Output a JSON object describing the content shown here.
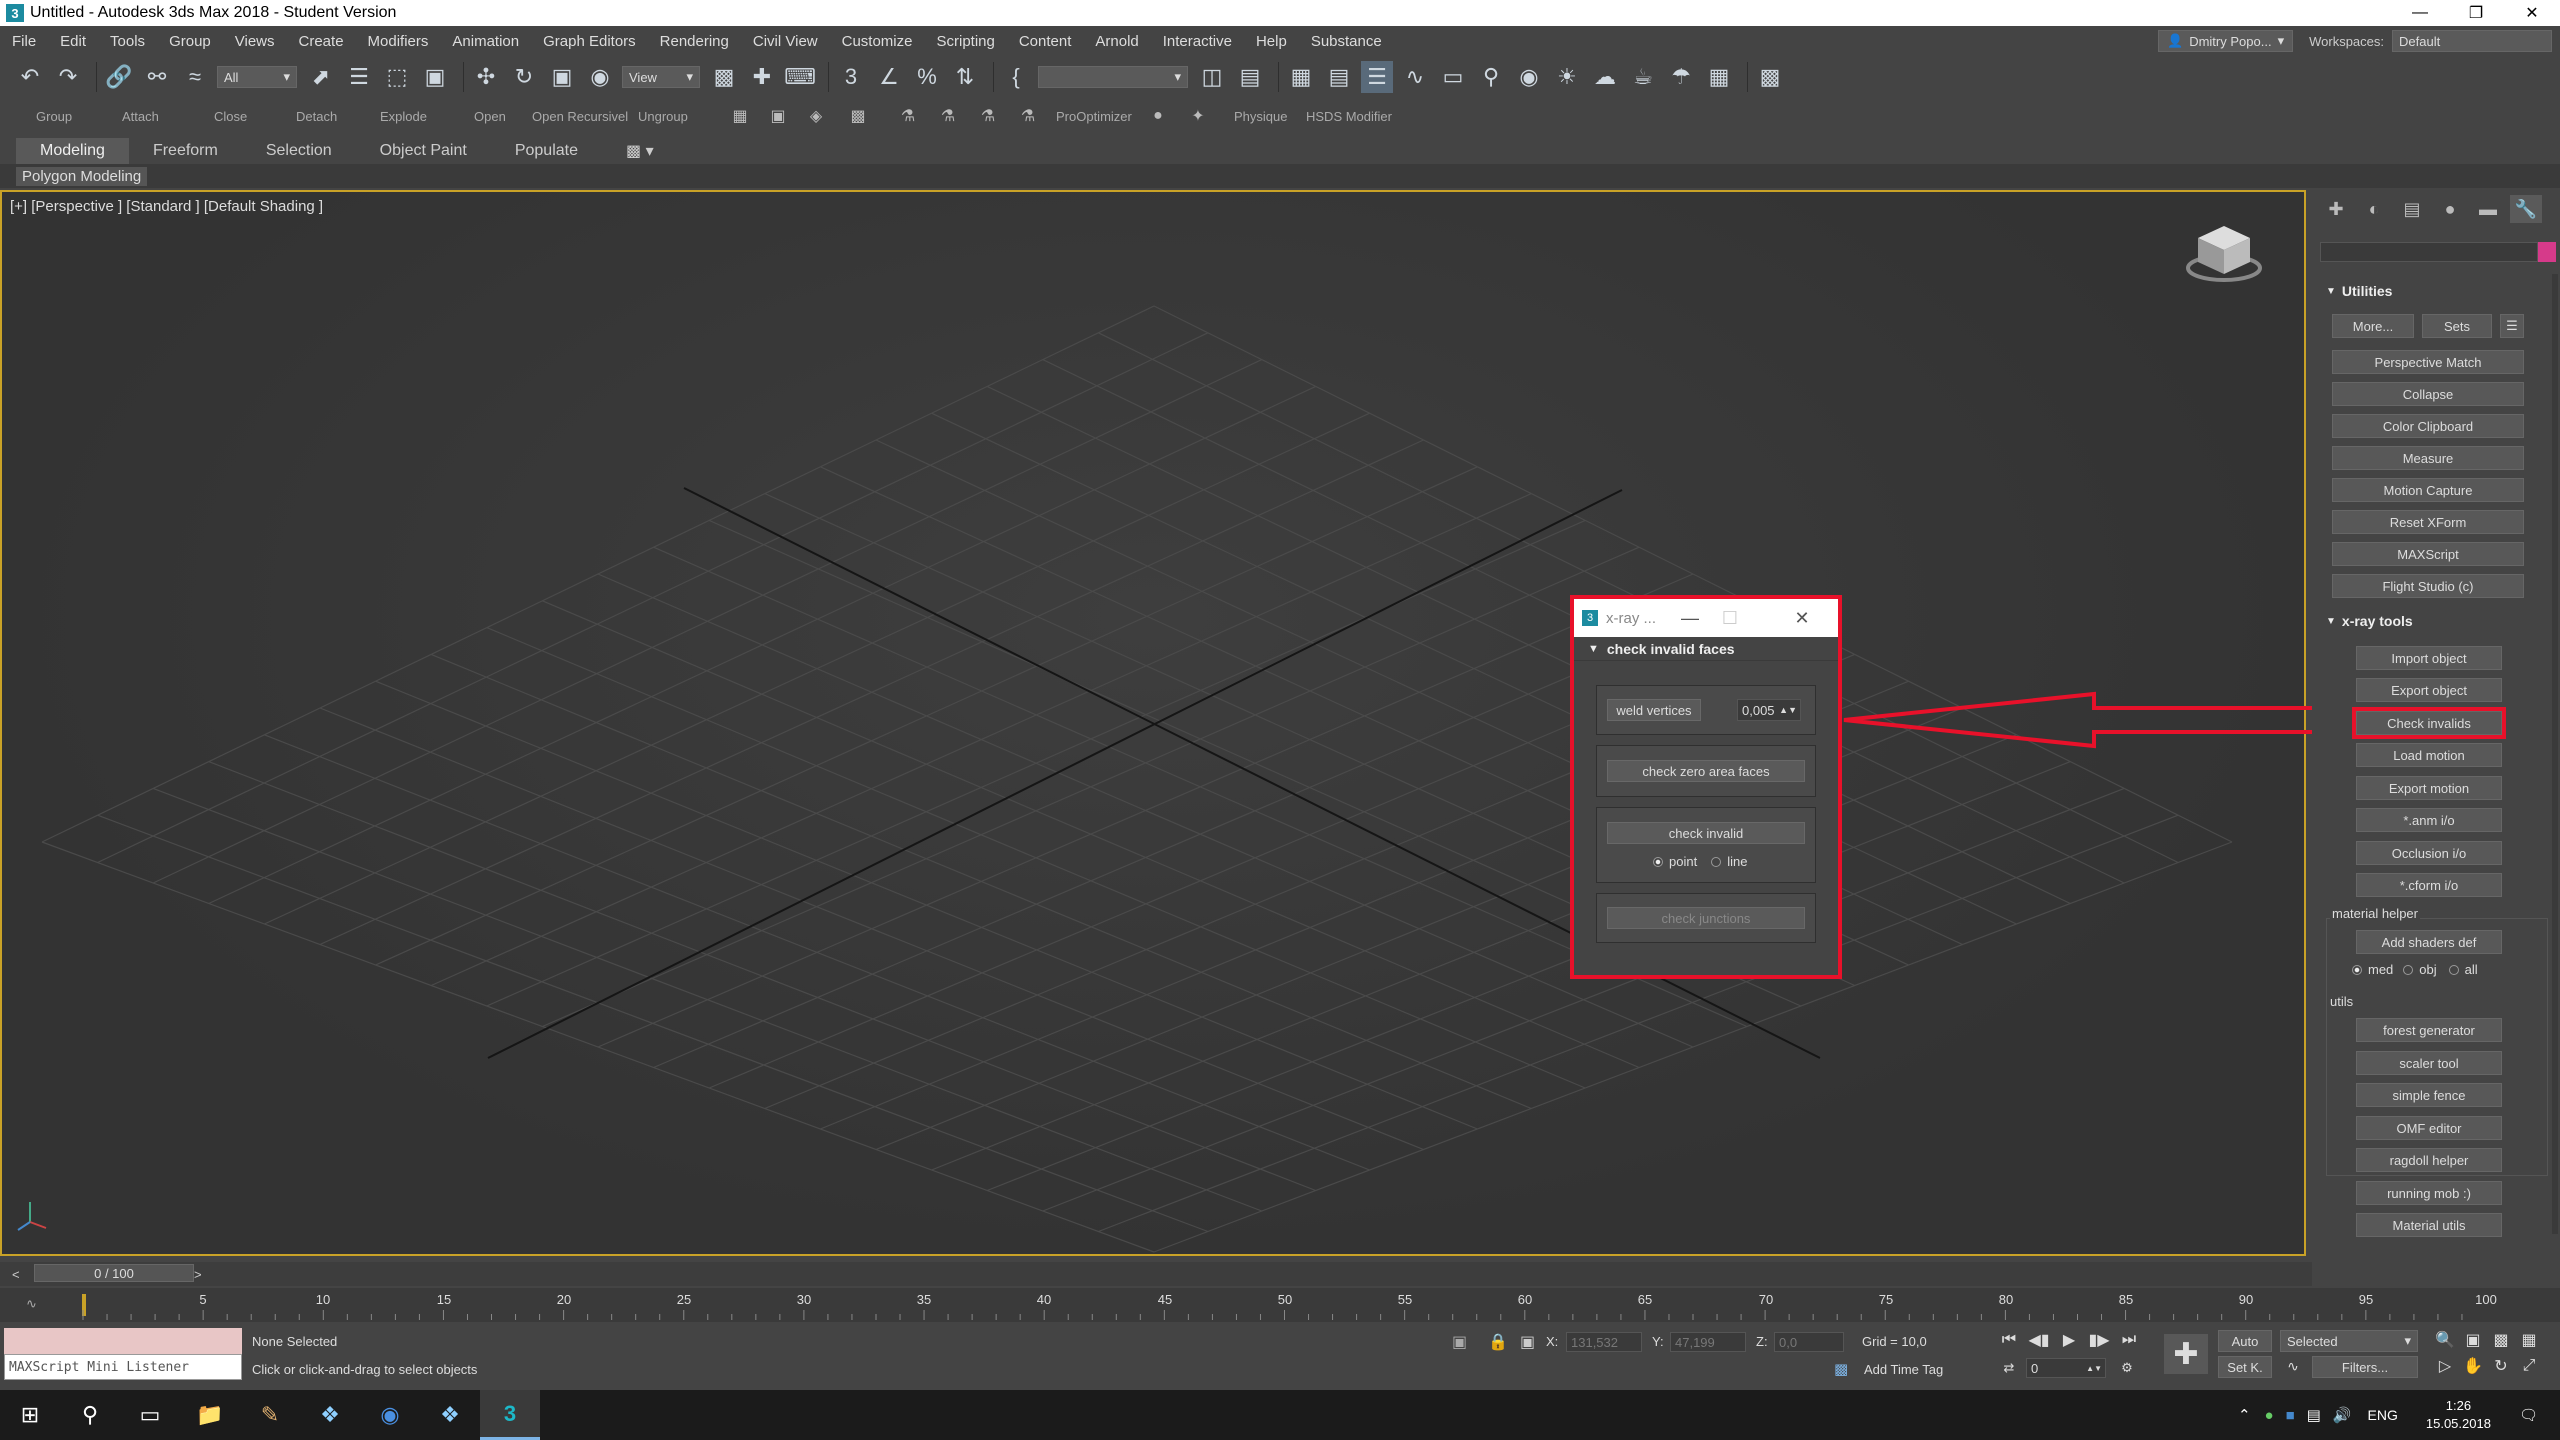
{
  "window": {
    "title": "Untitled - Autodesk 3ds Max 2018 - Student Version",
    "app_icon": "3",
    "controls": [
      "—",
      "❐",
      "✕"
    ]
  },
  "menu": {
    "items": [
      "File",
      "Edit",
      "Tools",
      "Group",
      "Views",
      "Create",
      "Modifiers",
      "Animation",
      "Graph Editors",
      "Rendering",
      "Civil View",
      "Customize",
      "Scripting",
      "Content",
      "Arnold",
      "Interactive",
      "Help",
      "Substance"
    ],
    "user": "Dmitry Popo...",
    "workspaces_label": "Workspaces:",
    "workspace_value": "Default"
  },
  "toolbar": {
    "filter_value": "All",
    "ref_coord_value": "View"
  },
  "commands": {
    "labels": [
      "Group",
      "Attach",
      "Close",
      "Detach",
      "Explode",
      "Open",
      "Open Recursivel",
      "Ungroup",
      "ProOptimizer",
      "Physique",
      "HSDS Modifier"
    ]
  },
  "ribbon": {
    "tabs": [
      "Modeling",
      "Freeform",
      "Selection",
      "Object Paint",
      "Populate"
    ],
    "active_tab": "Modeling",
    "sub_label": "Polygon Modeling"
  },
  "viewport": {
    "label": "[+] [Perspective ] [Standard ] [Default Shading ]"
  },
  "xray_dialog": {
    "title": "x-ray ...",
    "rollout_title": "check invalid faces",
    "weld_vertices_label": "weld vertices",
    "weld_value": "0,005",
    "check_zero_area_label": "check zero area faces",
    "check_invalid_label": "check invalid",
    "radio_point": "point",
    "radio_line": "line",
    "check_junctions_label": "check junctions"
  },
  "command_panel": {
    "accent_color": "#d63a8a",
    "utilities_title": "Utilities",
    "more_label": "More...",
    "sets_label": "Sets",
    "utilities": [
      "Perspective Match",
      "Collapse",
      "Color Clipboard",
      "Measure",
      "Motion Capture",
      "Reset XForm",
      "MAXScript",
      "Flight Studio (c)"
    ],
    "xray_title": "x-ray tools",
    "xray_tools": [
      "Import object",
      "Export object",
      "Check invalids",
      "Load motion",
      "Export motion",
      "*.anm i/o",
      "Occlusion i/o",
      "*.cform i/o"
    ],
    "material_helper_label": "material helper",
    "add_shaders_label": "Add shaders def",
    "mh_radio": [
      "med",
      "obj",
      "all"
    ],
    "utils_label": "utils",
    "utils": [
      "forest generator",
      "scaler tool",
      "simple fence",
      "OMF editor",
      "ragdoll helper",
      "running mob :)",
      "Material utils"
    ]
  },
  "timeline": {
    "frame_display": "0 / 100",
    "ticks": [
      "5",
      "10",
      "15",
      "20",
      "25",
      "30",
      "35",
      "40",
      "45",
      "50",
      "55",
      "60",
      "65",
      "70",
      "75",
      "80",
      "85",
      "90",
      "95",
      "100"
    ]
  },
  "status": {
    "maxscript_label": "MAXScript Mini Listener",
    "selection_text": "None Selected",
    "prompt_text": "Click or click-and-drag to select objects",
    "x_label": "X:",
    "x_value": "131,532",
    "y_label": "Y:",
    "y_value": "47,199",
    "z_label": "Z:",
    "z_value": "0,0",
    "grid_text": "Grid = 10,0",
    "add_time_tag": "Add Time Tag",
    "auto_label": "Auto",
    "selected_value": "Selected",
    "setk_label": "Set K.",
    "filters_label": "Filters...",
    "frame_value": "0"
  },
  "taskbar": {
    "lang": "ENG",
    "time": "1:26",
    "date": "15.05.2018"
  }
}
